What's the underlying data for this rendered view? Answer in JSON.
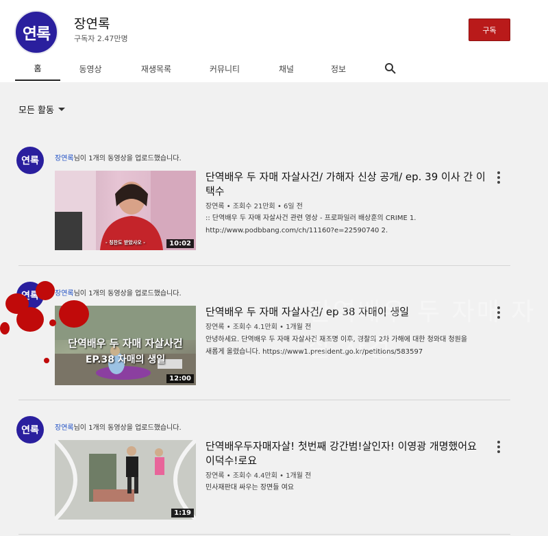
{
  "channel": {
    "avatar_text": "연록",
    "name": "장연록",
    "subscribers": "구독자 2.47만명",
    "subscribe_label": "구독"
  },
  "tabs": [
    {
      "label": "홈",
      "active": true
    },
    {
      "label": "동영상",
      "active": false
    },
    {
      "label": "재생목록",
      "active": false
    },
    {
      "label": "커뮤니티",
      "active": false
    },
    {
      "label": "채널",
      "active": false
    },
    {
      "label": "정보",
      "active": false
    }
  ],
  "icons": {
    "search": "search-icon",
    "filter_caret": "caret-down-icon",
    "more": "more-vert-icon"
  },
  "filter_label": "모든 활동",
  "activities": [
    {
      "avatar_text": "연록",
      "actor": "장연록",
      "action_text": "님이 1개의 동영상을 업로드했습니다.",
      "title": "단역배우 두 자매 자살사건/ 가해자 신상 공개/ ep. 39 이사 간 이택수",
      "meta": "장연록 • 조회수 21만회 • 6일 전",
      "desc_line1": ":: 단역배우 두 자매 자살사건 관련 영상 - 프로파일러 배상훈의 CRIME 1.",
      "desc_line2": "http://www.podbbang.com/ch/11160?e=22590740 2.",
      "duration": "10:02",
      "thumb_caption": "- 칭찬도 받았사오 -"
    },
    {
      "avatar_text": "연록",
      "actor": "장연록",
      "action_text": "님이 1개의 동영상을 업로드했습니다.",
      "title": "단역배우 두 자매 자살사건/ ep 38 자매이 생일",
      "meta": "장연록 • 조회수 4.1만회 • 1개월 전",
      "desc_line1": "안녕하세요. 단역배우 두 자매 자살사건 재조명 이후, 경찰의 2차 가해에 대한 청와대 청원을",
      "desc_line2": "새롭게 올렸습니다. https://www1.president.go.kr/petitions/583597",
      "duration": "12:00",
      "thumb_caption": "단역배우 두 자매 자살사건",
      "thumb_caption2": "EP.38 자매의 생일"
    },
    {
      "avatar_text": "연록",
      "actor": "장연록",
      "action_text": "님이 1개의 동영상을 업로드했습니다.",
      "title": "단역배우두자매자살! 첫번째 강간범!살인자! 이영광 개명했어요 이덕수!로요",
      "meta": "장연록 • 조회수 4.4만회 • 1개월 전",
      "desc_line1": "민사재판대 싸우는 장면들 여요",
      "duration": "1:19"
    }
  ],
  "watermark_text": "단역배우 두 자매 자살 사건",
  "colors": {
    "avatar": "#2a1f9e",
    "subscribe": "#b91a1a",
    "link": "#1f4fc4"
  }
}
